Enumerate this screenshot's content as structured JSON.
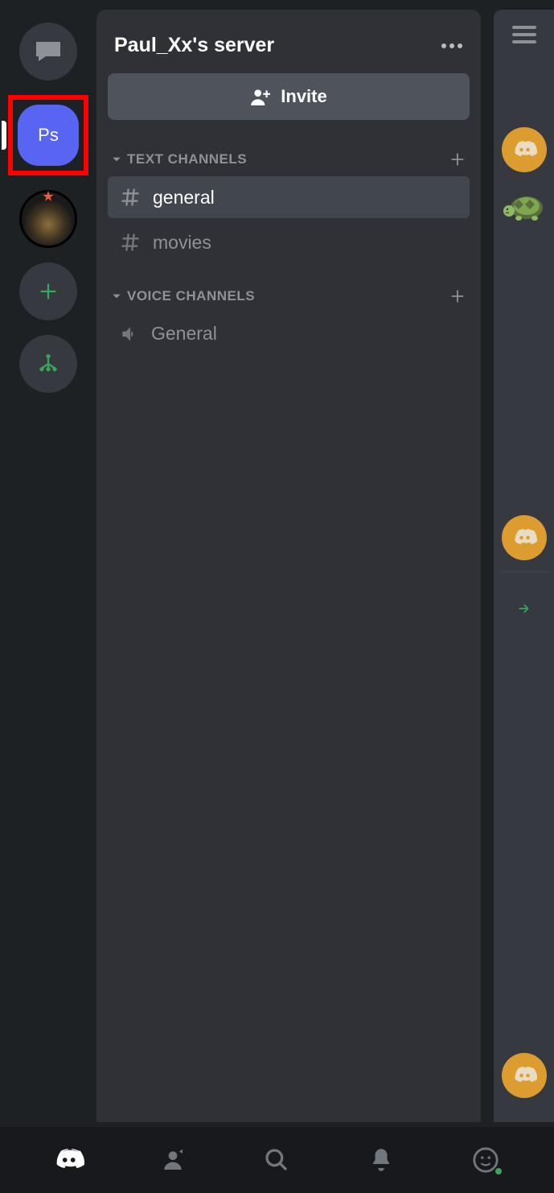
{
  "serverList": {
    "selectedServerLabel": "Ps"
  },
  "header": {
    "title": "Paul_Xx's server"
  },
  "inviteButton": {
    "label": "Invite"
  },
  "categories": {
    "text": {
      "label": "TEXT CHANNELS"
    },
    "voice": {
      "label": "VOICE CHANNELS"
    }
  },
  "textChannels": [
    {
      "name": "general",
      "active": true
    },
    {
      "name": "movies",
      "active": false
    }
  ],
  "voiceChannels": [
    {
      "name": "General"
    }
  ]
}
